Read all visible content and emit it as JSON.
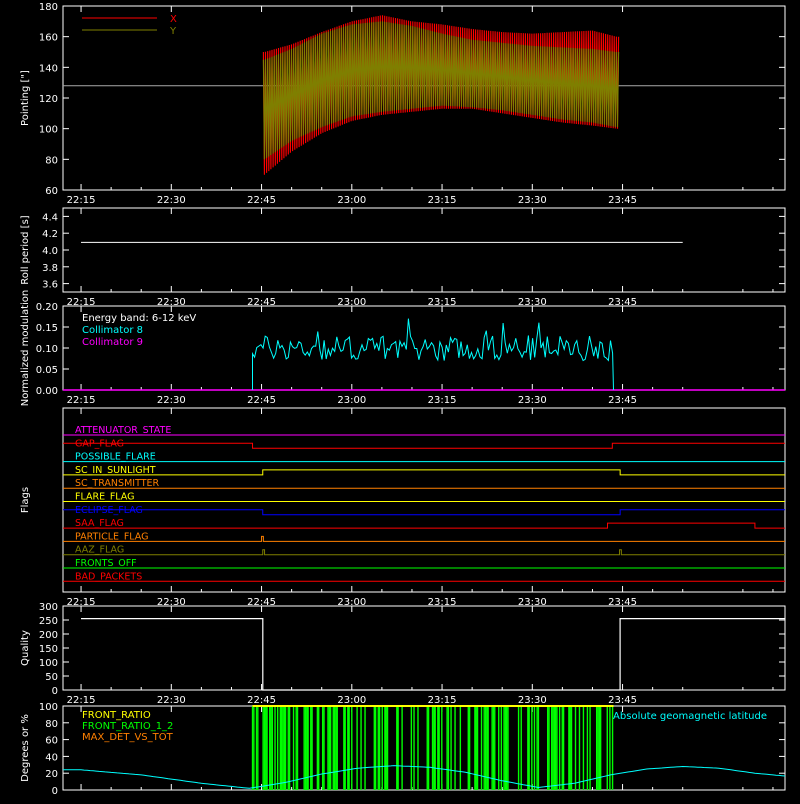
{
  "chart_data": [
    {
      "type": "line",
      "id": "pointing",
      "ylabel": "Pointing [\"]",
      "ylim": [
        60,
        180
      ],
      "y_ticks": [
        60,
        80,
        100,
        120,
        140,
        160,
        180
      ],
      "x_tick_labels": [
        "22:15",
        "22:30",
        "22:45",
        "23:00",
        "23:15",
        "23:30",
        "23:45"
      ],
      "reference_line": 128,
      "x_range_minutes": [
        30.3,
        89.5
      ],
      "series": [
        {
          "name": "X",
          "color": "#ff0000",
          "x": [
            30.5,
            35,
            40,
            45,
            50,
            55,
            60,
            65,
            70,
            75,
            80,
            85,
            89
          ],
          "upper": [
            150,
            155,
            163,
            170,
            174,
            170,
            168,
            165,
            163,
            162,
            163,
            164,
            160
          ],
          "lower": [
            70,
            85,
            97,
            105,
            109,
            111,
            113,
            113,
            110,
            107,
            104,
            102,
            100
          ]
        },
        {
          "name": "Y",
          "color": "#7f7f00",
          "x": [
            30.5,
            35,
            40,
            45,
            50,
            55,
            60,
            65,
            70,
            75,
            80,
            85,
            89
          ],
          "upper": [
            145,
            152,
            162,
            168,
            170,
            167,
            162,
            158,
            156,
            154,
            153,
            152,
            150
          ],
          "lower": [
            80,
            92,
            101,
            108,
            111,
            113,
            115,
            114,
            112,
            109,
            106,
            104,
            101
          ]
        }
      ]
    },
    {
      "type": "line",
      "id": "roll",
      "ylabel": "Roll period [s]",
      "ylim": [
        3.5,
        4.5
      ],
      "y_ticks": [
        3.6,
        3.8,
        4.0,
        4.2,
        4.4
      ],
      "x_tick_labels": [
        "22:15",
        "22:30",
        "22:45",
        "23:00",
        "23:15",
        "23:30",
        "23:45"
      ],
      "series": [
        {
          "name": "",
          "color": "#ffffff",
          "x": [
            0,
            100
          ],
          "y": [
            4.09,
            4.09
          ]
        }
      ]
    },
    {
      "type": "line",
      "id": "modulation",
      "ylabel": "Normalized modulation",
      "ylim": [
        0,
        0.2
      ],
      "y_ticks": [
        0.0,
        0.05,
        0.1,
        0.15,
        0.2
      ],
      "x_tick_labels": [
        "22:15",
        "22:30",
        "22:45",
        "23:00",
        "23:15",
        "23:30",
        "23:45"
      ],
      "legend": [
        "Energy band: 6-12 keV",
        "Collimator 8",
        "Collimator 9"
      ],
      "legend_colors": [
        "#ffffff",
        "#00ffff",
        "#ff00ff"
      ],
      "collimator8_range_minutes": [
        28.5,
        88.5
      ],
      "collimator8_mean": 0.1,
      "collimator8_spread": 0.03,
      "collimator9_level": 0.0
    },
    {
      "type": "line",
      "id": "flags",
      "ylabel": "Flags",
      "x_tick_labels": [
        "22:15",
        "22:30",
        "22:45",
        "23:00",
        "23:15",
        "23:30",
        "23:45"
      ],
      "flags": [
        {
          "name": "ATTENUATOR_STATE",
          "color": "#ff00ff",
          "steps": []
        },
        {
          "name": "GAP_FLAG",
          "color": "#ff0000",
          "steps": [
            [
              28.5,
              1
            ],
            [
              88.3,
              1
            ]
          ]
        },
        {
          "name": "POSSIBLE_FLARE",
          "color": "#00ffff",
          "steps": []
        },
        {
          "name": "SC_IN_SUNLIGHT",
          "color": "#ffff00",
          "steps": [
            [
              30.2,
              1
            ],
            [
              89.6,
              -1
            ]
          ]
        },
        {
          "name": "SC_TRANSMITTER",
          "color": "#ff8000",
          "steps": []
        },
        {
          "name": "FLARE_FLAG",
          "color": "#ffff00",
          "steps": []
        },
        {
          "name": "ECLIPSE_FLAG",
          "color": "#0000ff",
          "steps": [
            [
              30.2,
              -1
            ],
            [
              89.6,
              1
            ]
          ]
        },
        {
          "name": "SAA_FLAG",
          "color": "#ff0000",
          "steps": [
            [
              87.5,
              1
            ],
            [
              112,
              -1
            ]
          ]
        },
        {
          "name": "PARTICLE_FLAG",
          "color": "#ff8000",
          "spikes": [
            30
          ]
        },
        {
          "name": "AAZ_FLAG",
          "color": "#7f7f00",
          "spikes": [
            30.2,
            89.5
          ]
        },
        {
          "name": "FRONTS_OFF",
          "color": "#00ff00",
          "steps": []
        },
        {
          "name": "BAD_PACKETS",
          "color": "#ff0000",
          "steps": []
        }
      ]
    },
    {
      "type": "line",
      "id": "quality",
      "ylabel": "Quality",
      "ylim": [
        0,
        300
      ],
      "y_ticks": [
        0,
        50,
        100,
        150,
        200,
        250,
        300
      ],
      "x_tick_labels": [
        "22:15",
        "22:30",
        "22:45",
        "23:00",
        "23:15",
        "23:30",
        "23:45"
      ],
      "series": [
        {
          "name": "",
          "color": "#ffffff",
          "x": [
            0,
            30.2,
            30.2,
            89.6,
            89.6,
            120
          ],
          "y": [
            255,
            255,
            0,
            0,
            255,
            255
          ]
        }
      ]
    },
    {
      "type": "area",
      "id": "ratios",
      "ylabel": "Degrees or %",
      "ylim": [
        0,
        100
      ],
      "y_ticks": [
        0,
        20,
        40,
        60,
        80,
        100
      ],
      "legend": [
        "FRONT_RATIO",
        "FRONT_RATIO_1_2",
        "MAX_DET_VS_TOT"
      ],
      "legend_colors": [
        "#ffff00",
        "#00ff00",
        "#ff8000"
      ],
      "right_label": "Absolute geomagnetic latitude",
      "right_label_color": "#00ffff",
      "front_ratio_range_minutes": [
        28.5,
        88.5
      ],
      "latitude": {
        "x": [
          0,
          10,
          20,
          28,
          34,
          40,
          46,
          52,
          58,
          64,
          70,
          76,
          82,
          88,
          94,
          100,
          106,
          112,
          118
        ],
        "y": [
          24,
          18,
          8,
          2,
          9,
          19,
          26,
          29,
          27,
          21,
          11,
          3,
          8,
          18,
          25,
          28,
          26,
          20,
          16
        ]
      }
    }
  ]
}
